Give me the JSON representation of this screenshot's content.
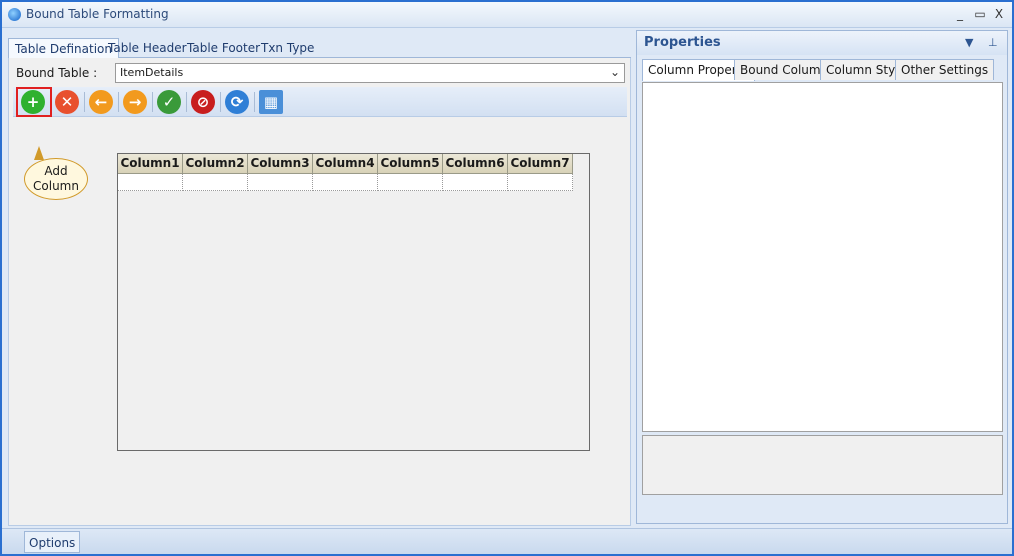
{
  "window": {
    "title": "Bound Table Formatting",
    "minimize": "_",
    "maximize": "▭",
    "close": "X"
  },
  "tabs": [
    {
      "label": "Table Defination",
      "active": true
    },
    {
      "label": "Table Header"
    },
    {
      "label": "Table Footer"
    },
    {
      "label": "Txn Type"
    }
  ],
  "bound_table": {
    "label": "Bound Table :",
    "value": "ItemDetails"
  },
  "toolbar": {
    "buttons": [
      {
        "icon": "add-icon",
        "glyph": "+",
        "color": "#2fb12f"
      },
      {
        "icon": "delete-icon",
        "glyph": "✕",
        "color": "#e8502e"
      },
      {
        "icon": "move-left-icon",
        "glyph": "←",
        "color": "#f29a1e"
      },
      {
        "icon": "move-right-icon",
        "glyph": "→",
        "color": "#f29a1e"
      },
      {
        "icon": "shield-check-icon",
        "glyph": "✓",
        "color": "#3a9a3a"
      },
      {
        "icon": "stop-icon",
        "glyph": "⊘",
        "color": "#c81e1e"
      },
      {
        "icon": "refresh-icon",
        "glyph": "⟳",
        "color": "#2f7fd6"
      },
      {
        "icon": "grid-layout-icon",
        "glyph": "▦",
        "color": "#4a8fd8"
      }
    ]
  },
  "callout": {
    "line1": "Add",
    "line2": "Column"
  },
  "grid": {
    "columns": [
      "Column1",
      "Column2",
      "Column3",
      "Column4",
      "Column5",
      "Column6",
      "Column7"
    ]
  },
  "properties": {
    "title": "Properties",
    "tabs": [
      {
        "label": "Column Property",
        "active": true
      },
      {
        "label": "Bound Columns"
      },
      {
        "label": "Column Style"
      },
      {
        "label": "Other Settings"
      }
    ]
  },
  "status": {
    "options_label": "Options"
  }
}
